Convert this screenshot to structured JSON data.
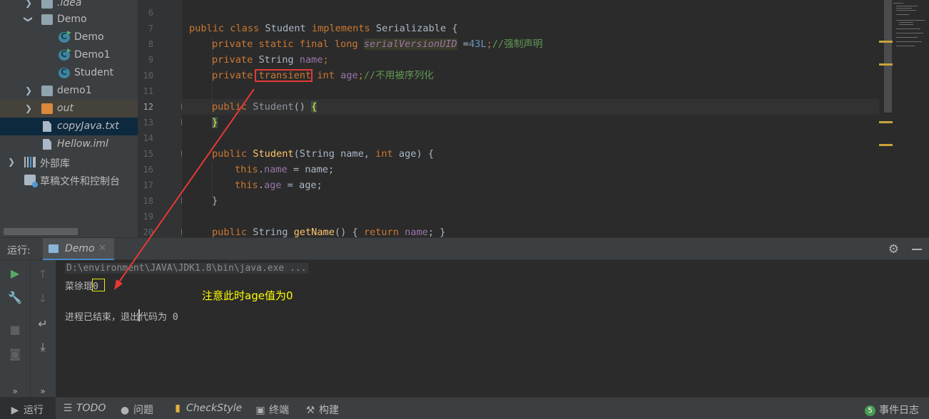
{
  "project_tree": {
    "items": [
      {
        "label": ".idea",
        "kind": "folder",
        "expanded": false
      },
      {
        "label": "Demo",
        "kind": "folder",
        "expanded": true
      },
      {
        "label": "Demo",
        "kind": "class-runnable"
      },
      {
        "label": "Demo1",
        "kind": "class-runnable"
      },
      {
        "label": "Student",
        "kind": "class"
      },
      {
        "label": "demo1",
        "kind": "folder",
        "expanded": false
      },
      {
        "label": "out",
        "kind": "folder-excluded",
        "expanded": false
      },
      {
        "label": "copyJava.txt",
        "kind": "text-file",
        "selected": true
      },
      {
        "label": "Hellow.iml",
        "kind": "iml-file"
      },
      {
        "label": "外部库",
        "kind": "libraries",
        "expanded": false
      },
      {
        "label": "草稿文件和控制台",
        "kind": "scratches"
      }
    ]
  },
  "editor": {
    "line_numbers": [
      "6",
      "7",
      "8",
      "9",
      "10",
      "11",
      "12",
      "13",
      "14",
      "15",
      "16",
      "17",
      "18",
      "19",
      "20"
    ],
    "current_line": "12",
    "lines": {
      "l7": {
        "k1": "public class ",
        "t1": "Student ",
        "k2": "implements ",
        "t2": "Serializable ",
        "b": "{"
      },
      "l8": {
        "k": "private static final long ",
        "sv": "serialVersionUID",
        "eq": " =",
        "num": "43L",
        "semi": ";",
        "cmt": "//强制声明"
      },
      "l9": {
        "k": "private ",
        "t": "String ",
        "f": "name",
        "semi": ";"
      },
      "l10": {
        "k": "private ",
        "tr": "transient",
        "k2": " int ",
        "f": "age",
        "semi": ";",
        "cmt": "//不用被序列化"
      },
      "l12": {
        "k": "public ",
        "fn": "Student",
        "p": "() ",
        "b": "{"
      },
      "l13": {
        "b": "}"
      },
      "l15": {
        "k": "public ",
        "fn": "Student",
        "p1": "(String name, ",
        "k2": "int ",
        "p2": "age) {"
      },
      "l16": {
        "k": "this",
        "dot": ".",
        "f": "name",
        "rest": " = name;"
      },
      "l17": {
        "k": "this",
        "dot": ".",
        "f": "age",
        "rest": " = age;"
      },
      "l18": {
        "b": "}"
      },
      "l20": {
        "k": "public ",
        "t": "String ",
        "fn": "getName",
        "p": "() { ",
        "k2": "return ",
        "f": "name",
        "end": "; }"
      }
    }
  },
  "run_panel": {
    "label": "运行:",
    "tab_label": "Demo",
    "console": {
      "command": "D:\\environment\\JAVA\\JDK1.8\\bin\\java.exe ...",
      "output_name": "菜徐琨",
      "output_age": "0",
      "exit_message": "进程已结束，退出代码为 0"
    },
    "annotation": "注意此时age值为0"
  },
  "bottom_bar": {
    "run": "运行",
    "todo": "TODO",
    "problems": "问题",
    "checkstyle": "CheckStyle",
    "terminal": "终端",
    "build": "构建",
    "event_log": "事件日志",
    "event_count": "5"
  },
  "colors": {
    "annotation_box": "#e53935",
    "annotation_text": "#ffff00",
    "console_highlight": "#e8e815"
  }
}
